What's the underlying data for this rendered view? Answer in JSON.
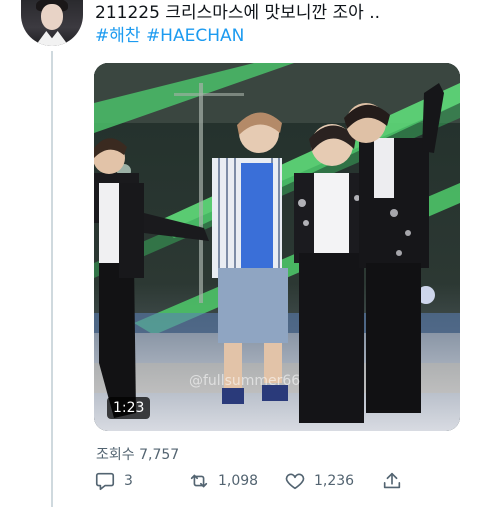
{
  "tweet": {
    "text_line1": "211225 크리스마스에 맛보니깐 조아 ..",
    "hashtags": [
      "#해찬",
      "#HAECHAN"
    ]
  },
  "video": {
    "duration": "1:23",
    "watermark": "@fullsummer66"
  },
  "stats": {
    "views": "조회수 7,757"
  },
  "actions": {
    "reply_count": "3",
    "retweet_count": "1,098",
    "like_count": "1,236"
  },
  "icons": {
    "reply": "reply-icon",
    "retweet": "retweet-icon",
    "like": "like-icon",
    "share": "share-icon"
  },
  "colors": {
    "accent": "#1d9bf0",
    "muted": "#536471"
  }
}
